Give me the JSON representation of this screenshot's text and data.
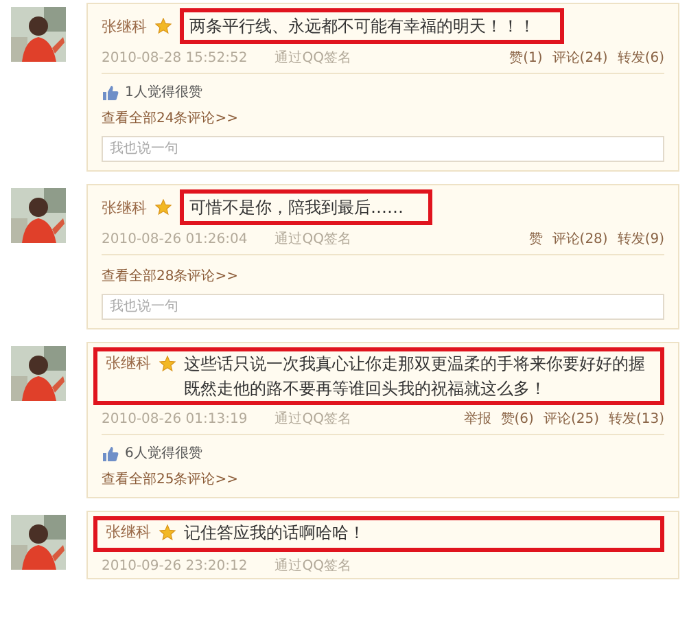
{
  "posts": [
    {
      "avatar": {
        "kind": "picture"
      },
      "author": "张继科",
      "kind": "textframe",
      "text": "两条平行线、永远都不可能有幸福的明天！！！",
      "time": "2010-08-28 15:52:52",
      "source": "通过QQ签名",
      "actions": [
        "赞(1)",
        "评论(24)",
        "转发(6)"
      ],
      "likes": "1人觉得很赞",
      "view_all": "查看全部24条评论>>",
      "reply_placeholder": "我也说一句"
    },
    {
      "avatar": {
        "kind": "picture"
      },
      "author": "张继科",
      "kind": "textframe",
      "text": "可惜不是你，陪我到最后……",
      "time": "2010-08-26 01:26:04",
      "source": "通过QQ签名",
      "actions": [
        "赞",
        "评论(28)",
        "转发(9)"
      ],
      "view_all": "查看全部28条评论>>",
      "reply_placeholder": "我也说一句"
    },
    {
      "avatar": {
        "kind": "picture"
      },
      "author": "张继科",
      "kind": "headframe",
      "text": "这些话只说一次我真心让你走那双更温柔的手将来你要好好的握既然走他的路不要再等谁回头我的祝福就这么多！",
      "time": "2010-08-26 01:13:19",
      "source": "通过QQ签名",
      "actions": [
        "举报",
        "赞(6)",
        "评论(25)",
        "转发(13)"
      ],
      "likes": "6人觉得很赞",
      "view_all": "查看全部25条评论>>"
    },
    {
      "avatar": {
        "kind": "picture"
      },
      "author": "张继科",
      "kind": "headframe",
      "text": "记住答应我的话啊哈哈！",
      "time": "2010-09-26 23:20:12",
      "source": "通过QQ签名"
    }
  ]
}
